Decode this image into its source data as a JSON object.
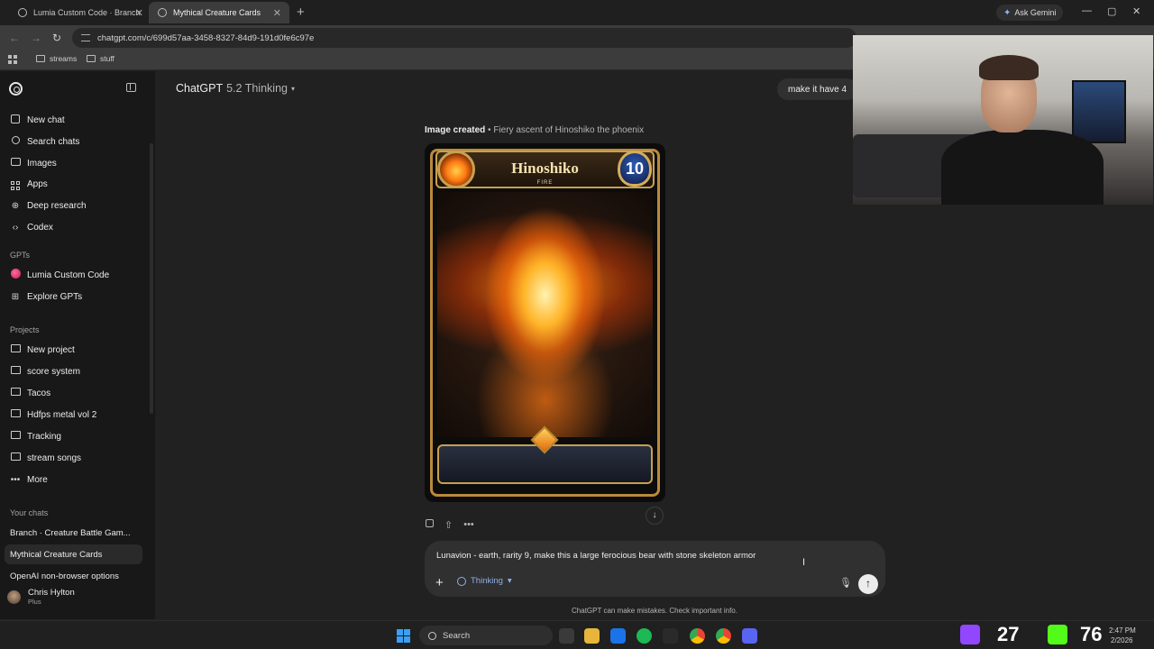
{
  "browser": {
    "tabs": [
      {
        "label": "Lumia Custom Code · Branch"
      },
      {
        "label": "Mythical Creature Cards"
      }
    ],
    "ask_gemini": "Ask Gemini",
    "url": "chatgpt.com/c/699d57aa-3458-8327-84d9-191d0fe6c97e",
    "bookmarks": [
      {
        "label": "streams"
      },
      {
        "label": "stuff"
      }
    ]
  },
  "sidebar": {
    "nav": [
      {
        "label": "New chat",
        "icon": "pencil-icon"
      },
      {
        "label": "Search chats",
        "icon": "search-icon"
      },
      {
        "label": "Images",
        "icon": "image-icon"
      },
      {
        "label": "Apps",
        "icon": "apps-icon"
      },
      {
        "label": "Deep research",
        "icon": "telescope-icon"
      },
      {
        "label": "Codex",
        "icon": "code-icon"
      }
    ],
    "gpts_heading": "GPTs",
    "gpts": [
      {
        "label": "Lumia Custom Code",
        "icon": "lumia-icon"
      },
      {
        "label": "Explore GPTs",
        "icon": "explore-icon"
      }
    ],
    "projects_heading": "Projects",
    "projects": [
      {
        "label": "New project"
      },
      {
        "label": "score system"
      },
      {
        "label": "Tacos"
      },
      {
        "label": "Hdfps metal vol 2"
      },
      {
        "label": "Tracking"
      },
      {
        "label": "stream songs"
      },
      {
        "label": "More"
      }
    ],
    "chats_heading": "Your chats",
    "chats": [
      {
        "label": "Branch · Creature Battle Gam..."
      },
      {
        "label": "Mythical Creature Cards"
      },
      {
        "label": "OpenAI non-browser options"
      }
    ],
    "user": {
      "name": "Chris Hylton",
      "plan": "Plus"
    }
  },
  "main": {
    "model_label": "ChatGPT",
    "model_version": "5.2 Thinking",
    "user_message": "make it have 4",
    "image_caption_bold": "Image created",
    "image_caption": "• Fiery ascent of Hinoshiko the phoenix",
    "card": {
      "name": "Hinoshiko",
      "element": "FIRE",
      "rarity": "10"
    },
    "composer": {
      "text": "Lunavion - earth, rarity 9, make this a large ferocious bear with stone skeleton armor",
      "mode": "Thinking"
    },
    "disclaimer": "ChatGPT can make mistakes. Check important info."
  },
  "taskbar": {
    "search": "Search",
    "counter_a": "27",
    "counter_b": "76",
    "time": "2:47 PM",
    "date": "2/2026"
  },
  "colors": {
    "accent_blue": "#8fb0e8",
    "background": "#212121",
    "sidebar": "#181818"
  }
}
